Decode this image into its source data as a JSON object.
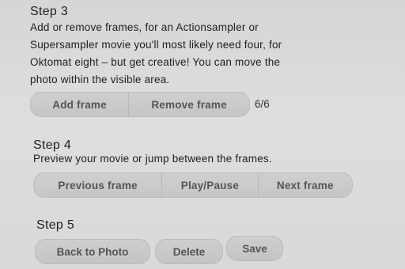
{
  "step3": {
    "title": "Step 3",
    "desc_lines": [
      "Add or remove frames, for an Actionsampler or",
      "Supersampler movie you'll most likely need four, for",
      "Oktomat eight – but get creative! You can move the",
      "photo within the visible area."
    ],
    "add_label": "Add frame",
    "remove_label": "Remove frame",
    "counter": "6/6"
  },
  "step4": {
    "title": "Step 4",
    "desc": "Preview your movie or jump between the frames.",
    "prev_label": "Previous frame",
    "play_label": "Play/Pause",
    "next_label": "Next frame"
  },
  "step5": {
    "title": "Step 5",
    "back_label": "Back to Photo",
    "delete_label": "Delete",
    "save_label": "Save"
  }
}
